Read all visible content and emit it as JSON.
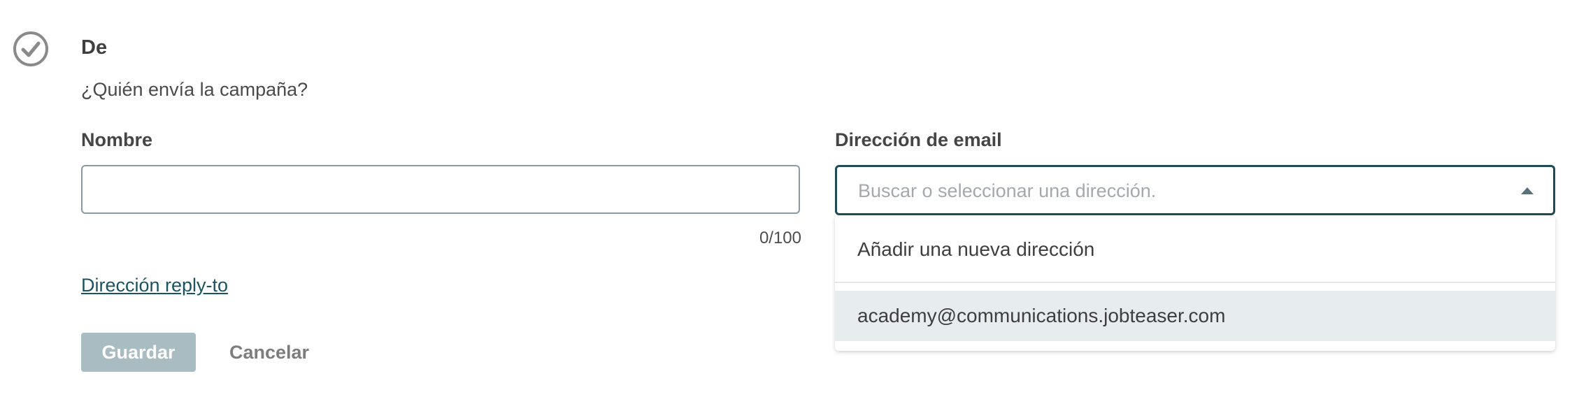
{
  "section": {
    "icon": "check-circle-icon",
    "title": "De",
    "subtitle": "¿Quién envía la campaña?"
  },
  "name_field": {
    "label": "Nombre",
    "value": "",
    "counter": "0/100"
  },
  "email_field": {
    "label": "Dirección de email",
    "placeholder": "Buscar o seleccionar una dirección.",
    "caret_icon": "caret-up-icon",
    "dropdown": {
      "add_label": "Añadir una nueva dirección",
      "options": [
        "academy@communications.jobteaser.com"
      ]
    }
  },
  "reply_to_link": "Dirección reply-to",
  "actions": {
    "save_label": "Guardar",
    "cancel_label": "Cancelar"
  },
  "colors": {
    "accent": "#1f4b55",
    "save_disabled_bg": "#a8bcc2",
    "link": "#1b5460",
    "option_hover_bg": "#e7ecee"
  }
}
